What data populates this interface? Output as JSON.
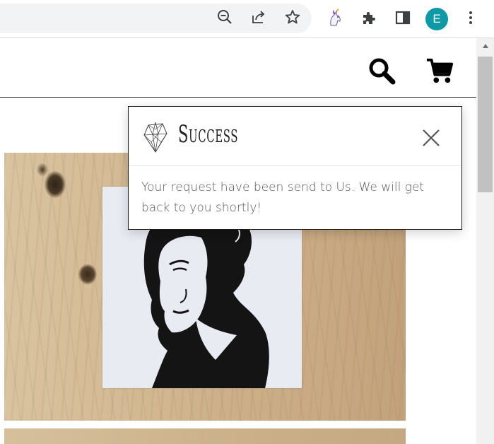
{
  "browser": {
    "toolbar_icons": [
      "zoom-out-icon",
      "share-icon",
      "bookmark-star-icon",
      "unicorn-extension-icon",
      "extensions-puzzle-icon",
      "side-panel-icon",
      "more-menu-icon"
    ],
    "profile_initial": "E",
    "profile_color": "#0d9aa6"
  },
  "site": {
    "header_icons": [
      "search-icon",
      "cart-icon"
    ]
  },
  "modal": {
    "title": "Success",
    "message": "Your request have been send to Us. We will get back to you shortly!",
    "close_icon": "close-icon"
  }
}
